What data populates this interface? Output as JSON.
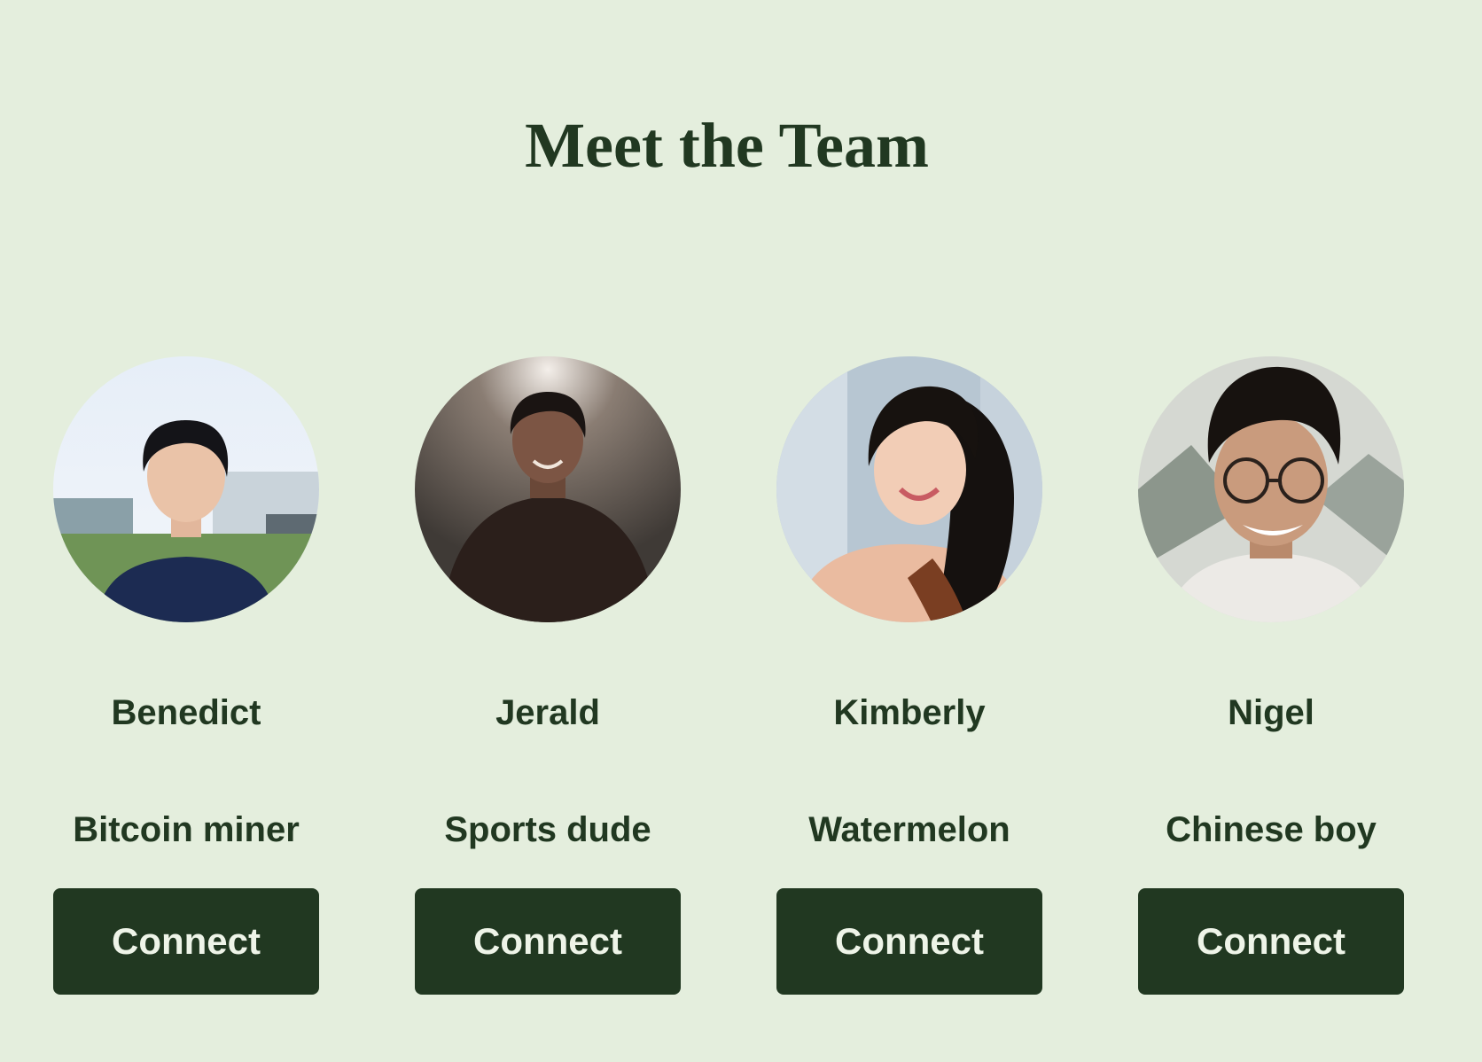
{
  "page": {
    "title": "Meet the Team"
  },
  "colors": {
    "background": "#e4eedd",
    "text": "#213821",
    "button_background": "#213821",
    "button_text": "#eef4e8"
  },
  "team": [
    {
      "name": "Benedict",
      "role": "Bitcoin miner",
      "button_label": "Connect",
      "avatar_icon": "profile-photo"
    },
    {
      "name": "Jerald",
      "role": "Sports dude",
      "button_label": "Connect",
      "avatar_icon": "profile-photo"
    },
    {
      "name": "Kimberly",
      "role": "Watermelon",
      "button_label": "Connect",
      "avatar_icon": "profile-photo"
    },
    {
      "name": "Nigel",
      "role": "Chinese boy",
      "button_label": "Connect",
      "avatar_icon": "profile-photo"
    }
  ]
}
